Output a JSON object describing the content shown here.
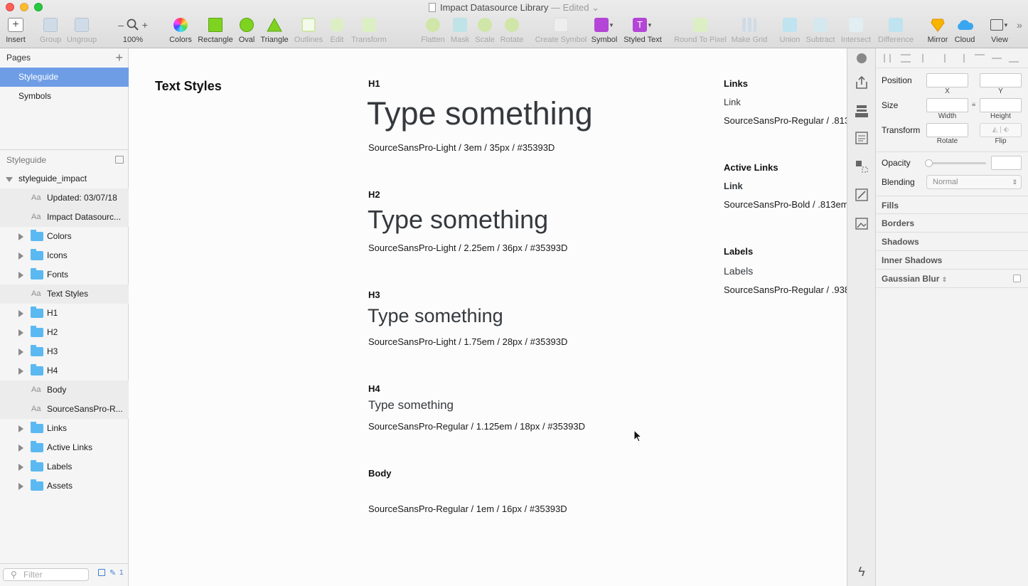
{
  "window": {
    "title": "Impact Datasource Library",
    "edited": "— Edited"
  },
  "toolbar": [
    {
      "id": "insert",
      "label": "Insert",
      "icon": "plus-icon"
    },
    {
      "id": "group",
      "label": "Group",
      "icon": "group-icon"
    },
    {
      "id": "ungroup",
      "label": "Ungroup",
      "icon": "ungroup-icon"
    },
    {
      "id": "zoom",
      "label": "100%",
      "icon": "magnifier-icon"
    },
    {
      "id": "colors",
      "label": "Colors",
      "icon": "color-wheel-icon"
    },
    {
      "id": "rectangle",
      "label": "Rectangle",
      "icon": "rectangle-icon"
    },
    {
      "id": "oval",
      "label": "Oval",
      "icon": "oval-icon"
    },
    {
      "id": "triangle",
      "label": "Triangle",
      "icon": "triangle-icon"
    },
    {
      "id": "outlines",
      "label": "Outlines",
      "icon": "outlines-icon"
    },
    {
      "id": "edit",
      "label": "Edit",
      "icon": "edit-icon"
    },
    {
      "id": "transform",
      "label": "Transform",
      "icon": "transform-icon"
    },
    {
      "id": "flatten",
      "label": "Flatten",
      "icon": "flatten-icon"
    },
    {
      "id": "mask",
      "label": "Mask",
      "icon": "mask-icon"
    },
    {
      "id": "scale",
      "label": "Scale",
      "icon": "scale-icon"
    },
    {
      "id": "rotate",
      "label": "Rotate",
      "icon": "rotate-icon"
    },
    {
      "id": "create_symbol",
      "label": "Create Symbol",
      "icon": "create-symbol-icon"
    },
    {
      "id": "symbol",
      "label": "Symbol",
      "icon": "symbol-icon"
    },
    {
      "id": "styled_text",
      "label": "Styled Text",
      "icon": "styled-text-icon"
    },
    {
      "id": "round_to_pixel",
      "label": "Round To Pixel",
      "icon": "round-to-pixel-icon"
    },
    {
      "id": "make_grid",
      "label": "Make Grid",
      "icon": "make-grid-icon"
    },
    {
      "id": "union",
      "label": "Union",
      "icon": "union-icon"
    },
    {
      "id": "subtract",
      "label": "Subtract",
      "icon": "subtract-icon"
    },
    {
      "id": "intersect",
      "label": "Intersect",
      "icon": "intersect-icon"
    },
    {
      "id": "difference",
      "label": "Difference",
      "icon": "difference-icon"
    },
    {
      "id": "mirror",
      "label": "Mirror",
      "icon": "mirror-icon"
    },
    {
      "id": "cloud",
      "label": "Cloud",
      "icon": "cloud-icon"
    },
    {
      "id": "view",
      "label": "View",
      "icon": "view-icon"
    }
  ],
  "pages": {
    "header": "Pages",
    "items": [
      "Styleguide",
      "Symbols"
    ],
    "selected": "Styleguide"
  },
  "layers": {
    "header": "Styleguide",
    "root": "styleguide_impact",
    "items": [
      {
        "type": "text",
        "label": "Updated: 03/07/18"
      },
      {
        "type": "text",
        "label": "Impact Datasourc..."
      },
      {
        "type": "folder",
        "label": "Colors"
      },
      {
        "type": "folder",
        "label": "Icons"
      },
      {
        "type": "folder",
        "label": "Fonts"
      },
      {
        "type": "text",
        "label": "Text Styles"
      },
      {
        "type": "folder",
        "label": "H1"
      },
      {
        "type": "folder",
        "label": "H2"
      },
      {
        "type": "folder",
        "label": "H3"
      },
      {
        "type": "folder",
        "label": "H4"
      },
      {
        "type": "text",
        "label": "Body"
      },
      {
        "type": "text",
        "label": "SourceSansPro-R..."
      },
      {
        "type": "folder",
        "label": "Links"
      },
      {
        "type": "folder",
        "label": "Active Links"
      },
      {
        "type": "folder",
        "label": "Labels"
      },
      {
        "type": "folder",
        "label": "Assets"
      }
    ],
    "filter_placeholder": "Filter",
    "filter_count": "1",
    "text_glyph": "Aa"
  },
  "canvas": {
    "section_title": "Text Styles",
    "styles": [
      {
        "heading": "H1",
        "sample": "Type something",
        "spec": "SourceSansPro-Light / 3em / 35px / #35393D"
      },
      {
        "heading": "H2",
        "sample": "Type something",
        "spec": "SourceSansPro-Light / 2.25em / 36px / #35393D"
      },
      {
        "heading": "H3",
        "sample": "Type something",
        "spec": "SourceSansPro-Light / 1.75em / 28px / #35393D"
      },
      {
        "heading": "H4",
        "sample": "Type something",
        "spec": "SourceSansPro-Regular / 1.125em / 18px / #35393D"
      },
      {
        "heading": "Body",
        "sample": "",
        "spec": "SourceSansPro-Regular / 1em / 16px / #35393D"
      }
    ],
    "side_styles": [
      {
        "heading": "Links",
        "sample": "Link",
        "spec": "SourceSansPro-Regular / .813"
      },
      {
        "heading": "Active Links",
        "sample": "Link",
        "spec": "SourceSansPro-Bold / .813em"
      },
      {
        "heading": "Labels",
        "sample": "Labels",
        "spec": "SourceSansPro-Regular / .938"
      }
    ],
    "text_color": "#35393D"
  },
  "inspector": {
    "position": "Position",
    "x": "X",
    "y": "Y",
    "size": "Size",
    "width": "Width",
    "height": "Height",
    "transform": "Transform",
    "rotate": "Rotate",
    "flip": "Flip",
    "opacity": "Opacity",
    "blending": "Blending",
    "blending_value": "Normal",
    "sections": [
      "Fills",
      "Borders",
      "Shadows",
      "Inner Shadows",
      "Gaussian Blur"
    ]
  },
  "colors": {
    "selection": "#6E9DE6",
    "folder": "#5AB9F0",
    "symbol": "#B445D6",
    "styled_text": "#B445D6",
    "rectangle": "#7ED321",
    "oval": "#7ED321"
  }
}
